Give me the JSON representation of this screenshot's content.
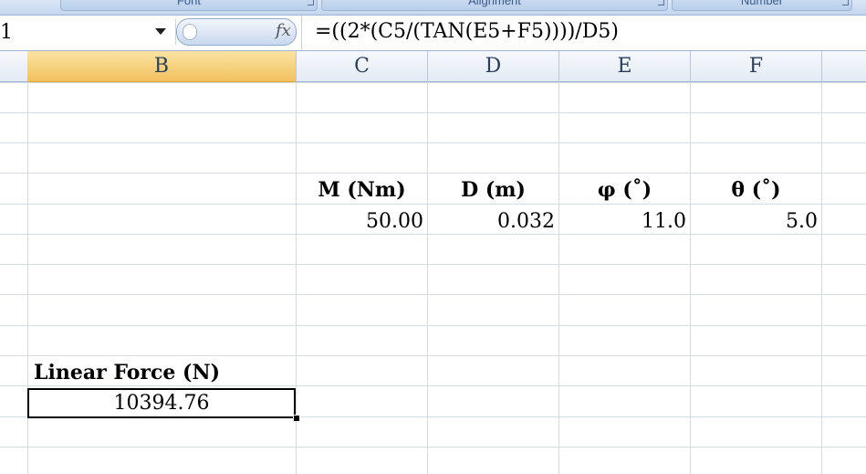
{
  "ribbon": {
    "groups": [
      {
        "label": "Font"
      },
      {
        "label": "Alignment"
      },
      {
        "label": "Number"
      }
    ]
  },
  "formula_bar": {
    "name_box": "1",
    "fx": "fx",
    "formula": "=((2*(C5/(TAN(E5+F5))))/D5)"
  },
  "columns": [
    {
      "label": ""
    },
    {
      "label": "B"
    },
    {
      "label": "C"
    },
    {
      "label": "D"
    },
    {
      "label": "E"
    },
    {
      "label": "F"
    }
  ],
  "cells": {
    "c4": "M (Nm)",
    "d4": "D (m)",
    "e4": "φ (˚)",
    "f4": "θ (˚)",
    "c5": "50.00",
    "d5": "0.032",
    "e5": "11.0",
    "f5": "5.0",
    "b10": "Linear Force (N)",
    "b11": "10394.76"
  },
  "colors": {
    "active_header": "#f1c15e",
    "grid_line": "#d4dbe5",
    "ribbon": "#c4d6ee"
  }
}
